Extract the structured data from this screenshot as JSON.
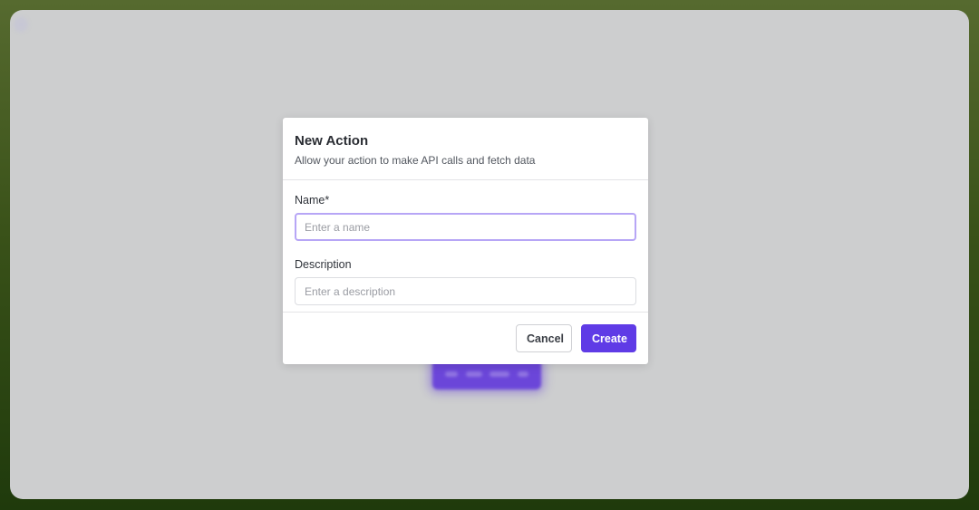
{
  "modal": {
    "title": "New Action",
    "subtitle": "Allow your action to make API calls and fetch data",
    "fields": {
      "name": {
        "label": "Name*",
        "value": "",
        "placeholder": "Enter a name"
      },
      "description": {
        "label": "Description",
        "value": "",
        "placeholder": "Enter a description"
      }
    },
    "buttons": {
      "cancel_label": "Cancel",
      "create_label": "Create"
    }
  },
  "colors": {
    "accent": "#5f3be6",
    "focus_ring": "#b7a6f6",
    "overlay": "#cdcecf"
  }
}
